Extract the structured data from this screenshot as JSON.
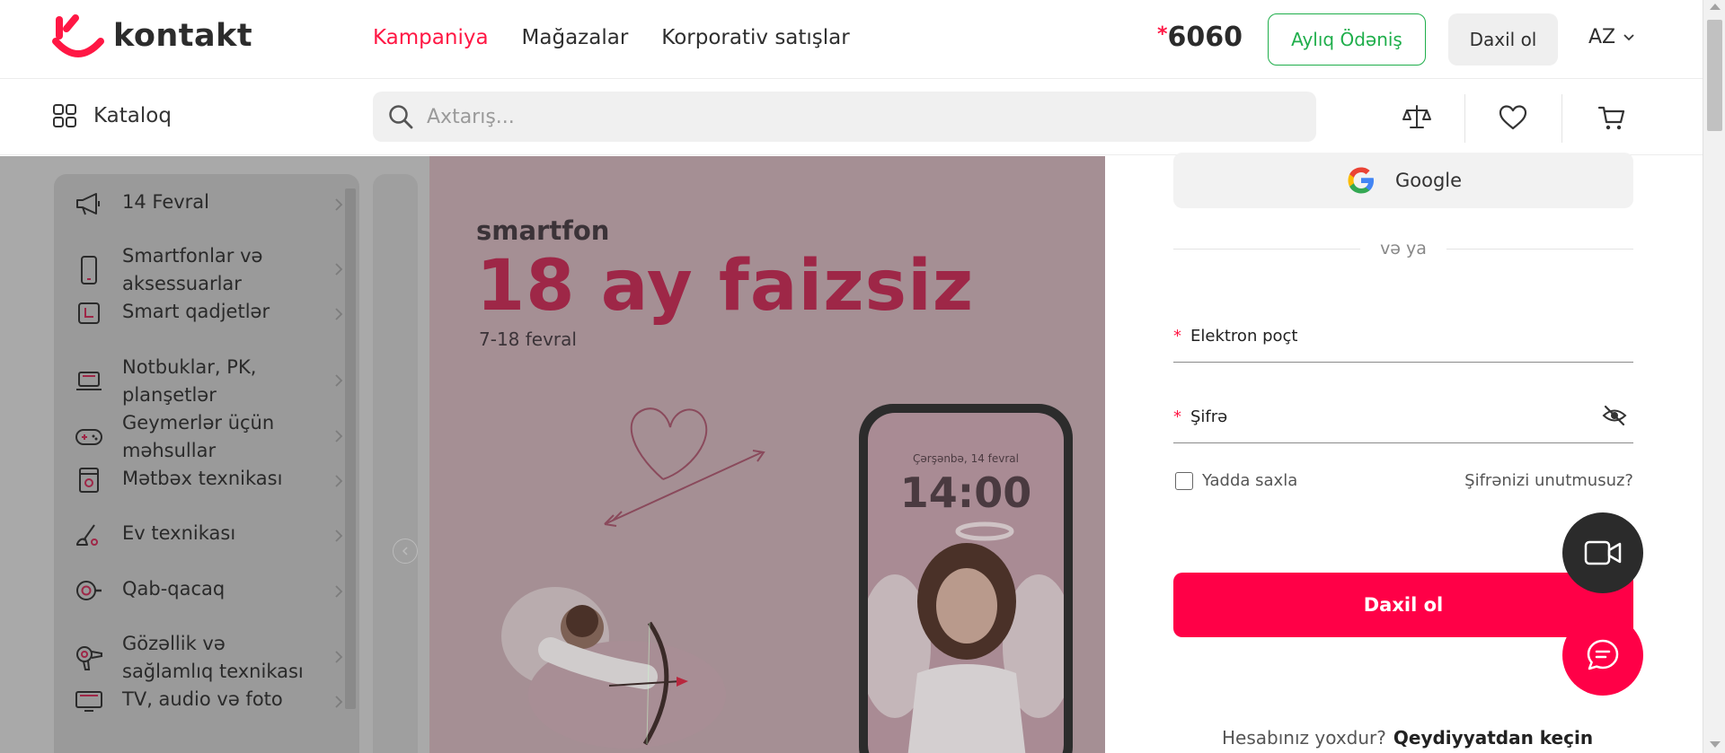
{
  "header": {
    "logo_text": "kontakt",
    "nav": [
      "Kampaniya",
      "Mağazalar",
      "Korporativ satışlar"
    ],
    "phone_star": "*",
    "phone": "6060",
    "monthly_payment": "Aylıq Ödəniş",
    "login": "Daxil ol",
    "language": "AZ"
  },
  "subbar": {
    "catalog": "Kataloq",
    "search_placeholder": "Axtarış..."
  },
  "sidebar": {
    "items": [
      {
        "label": "14 Fevral",
        "icon": "megaphone-icon"
      },
      {
        "label": "Smartfonlar və aksessuarlar",
        "icon": "smartphone-icon"
      },
      {
        "label": "Smart qadjetlər",
        "icon": "smartwatch-icon"
      },
      {
        "label": "Notbuklar, PK, planşetlər",
        "icon": "laptop-icon"
      },
      {
        "label": "Geymerlər üçün məhsullar",
        "icon": "gamepad-icon"
      },
      {
        "label": "Mətbəx texnikası",
        "icon": "kitchen-icon"
      },
      {
        "label": "Ev texnikası",
        "icon": "vacuum-icon"
      },
      {
        "label": "Qab-qacaq",
        "icon": "cookware-icon"
      },
      {
        "label": "Gözəllik və sağlamlıq texnikası",
        "icon": "hairdryer-icon"
      },
      {
        "label": "TV, audio və foto",
        "icon": "tv-icon"
      }
    ]
  },
  "banner": {
    "small_title": "smartfon",
    "big_title": "18 ay faizsiz",
    "dates": "7-18 fevral",
    "phone_date": "Çərşənbə, 14 fevral",
    "phone_time": "14:00"
  },
  "login_panel": {
    "google": "Google",
    "or": "və ya",
    "email_label": "Elektron poçt",
    "password_label": "Şifrə",
    "required_mark": "*",
    "remember": "Yadda saxla",
    "forgot": "Şifrənizi unutmusuz?",
    "submit": "Daxil ol",
    "no_account": "Hesabınız yoxdur?",
    "register": "Qeydiyyatdan keçin"
  },
  "colors": {
    "accent": "#ff1744",
    "submit": "#ff0047",
    "green": "#1fae4b",
    "banner_red": "#9e2747"
  }
}
